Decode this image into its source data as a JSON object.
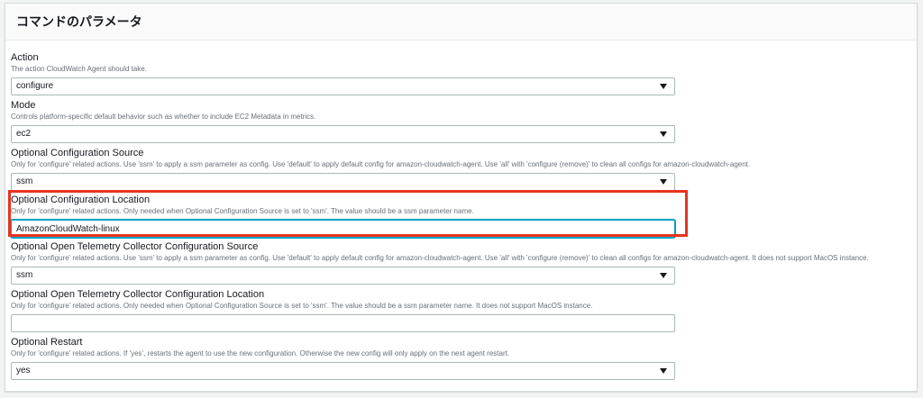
{
  "panel": {
    "title": "コマンドのパラメータ"
  },
  "fields": {
    "action": {
      "label": "Action",
      "description": "The action CloudWatch Agent should take.",
      "value": "configure"
    },
    "mode": {
      "label": "Mode",
      "description": "Controls platform-specific default behavior such as whether to include EC2 Metadata in metrics.",
      "value": "ec2"
    },
    "config_source": {
      "label": "Optional Configuration Source",
      "description": "Only for 'configure' related actions. Use 'ssm' to apply a ssm parameter as config. Use 'default' to apply default config for amazon-cloudwatch-agent. Use 'all' with 'configure (remove)' to clean all configs for amazon-cloudwatch-agent.",
      "value": "ssm"
    },
    "config_location": {
      "label": "Optional Configuration Location",
      "description": "Only for 'configure' related actions. Only needed when Optional Configuration Source is set to 'ssm'. The value should be a ssm parameter name.",
      "value": "AmazonCloudWatch-linux"
    },
    "otel_source": {
      "label": "Optional Open Telemetry Collector Configuration Source",
      "description": "Only for 'configure' related actions. Use 'ssm' to apply a ssm parameter as config. Use 'default' to apply default config for amazon-cloudwatch-agent. Use 'all' with 'configure (remove)' to clean all configs for amazon-cloudwatch-agent. It does not support MacOS instance.",
      "value": "ssm"
    },
    "otel_location": {
      "label": "Optional Open Telemetry Collector Configuration Location",
      "description": "Only for 'configure' related actions. Only needed when Optional Configuration Source is set to 'ssm'. The value should be a ssm parameter name. It does not support MacOS instance.",
      "value": ""
    },
    "restart": {
      "label": "Optional Restart",
      "description": "Only for 'configure' related actions. If 'yes', restarts the agent to use the new configuration. Otherwise the new config will only apply on the next agent restart.",
      "value": "yes"
    }
  },
  "colors": {
    "highlight": "#e8331d",
    "focus": "#00a1c9"
  }
}
